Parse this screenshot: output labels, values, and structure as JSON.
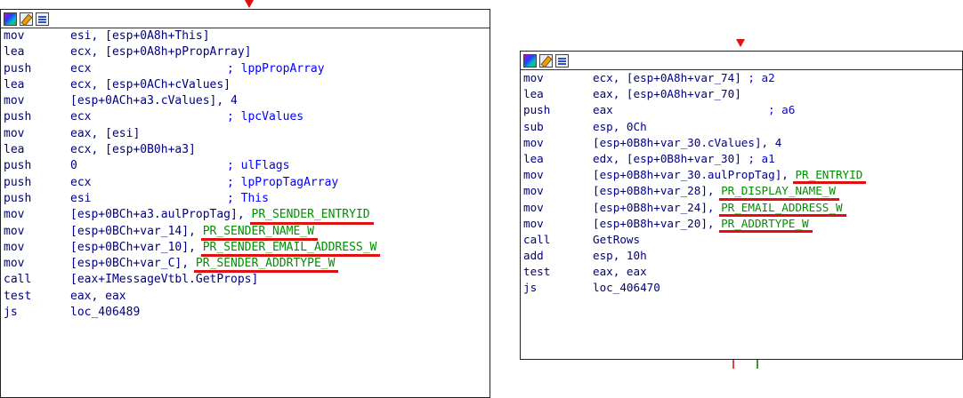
{
  "colors": {
    "mnemonic": "#000080",
    "comment": "#0000ff",
    "constant": "#008000",
    "underline": "#e01010",
    "arrow": "#e01010"
  },
  "panel_left": {
    "icons": [
      "graph-view-icon",
      "edit-icon",
      "list-view-icon"
    ],
    "lines": [
      {
        "m": "mov",
        "o": "esi, [esp+0A8h+This]"
      },
      {
        "m": "lea",
        "o": "ecx, [esp+0A8h+pPropArray]"
      },
      {
        "m": "push",
        "o": "ecx",
        "c": "; lppPropArray"
      },
      {
        "m": "lea",
        "o": "ecx, [esp+0ACh+cValues]"
      },
      {
        "m": "mov",
        "o": "[esp+0ACh+a3.cValues], 4"
      },
      {
        "m": "push",
        "o": "ecx",
        "c": "; lpcValues"
      },
      {
        "m": "mov",
        "o": "eax, [esi]"
      },
      {
        "m": "lea",
        "o": "ecx, [esp+0B0h+a3]"
      },
      {
        "m": "push",
        "o": "0",
        "c": "; ulFlags"
      },
      {
        "m": "push",
        "o": "ecx",
        "c": "; lpPropTagArray"
      },
      {
        "m": "push",
        "o": "esi",
        "c": "; This"
      },
      {
        "m": "mov",
        "o": "[esp+0BCh+a3.aulPropTag], ",
        "h": "PR_SENDER_ENTRYID"
      },
      {
        "m": "mov",
        "o": "[esp+0BCh+var_14], ",
        "h": "PR_SENDER_NAME_W"
      },
      {
        "m": "mov",
        "o": "[esp+0BCh+var_10], ",
        "h": "PR_SENDER_EMAIL_ADDRESS_W"
      },
      {
        "m": "mov",
        "o": "[esp+0BCh+var_C], ",
        "h": "PR_SENDER_ADDRTYPE_W"
      },
      {
        "m": "call",
        "o": "[eax+IMessageVtbl.GetProps]"
      },
      {
        "m": "test",
        "o": "eax, eax"
      },
      {
        "m": "js",
        "o": "loc_406489"
      }
    ]
  },
  "panel_right": {
    "icons": [
      "graph-view-icon",
      "edit-icon",
      "list-view-icon"
    ],
    "lines": [
      {
        "m": "mov",
        "o": "ecx, [esp+0A8h+var_74] ",
        "c": "; a2"
      },
      {
        "m": "lea",
        "o": "eax, [esp+0A8h+var_70]"
      },
      {
        "m": "push",
        "o": "eax",
        "c": "; a6"
      },
      {
        "m": "sub",
        "o": "esp, 0Ch"
      },
      {
        "m": "mov",
        "o": "[esp+0B8h+var_30.cValues], 4"
      },
      {
        "m": "lea",
        "o": "edx, [esp+0B8h+var_30] ",
        "c": "; a1"
      },
      {
        "m": "mov",
        "o": "[esp+0B8h+var_30.aulPropTag], ",
        "h": "PR_ENTRYID"
      },
      {
        "m": "mov",
        "o": "[esp+0B8h+var_28], ",
        "h": "PR_DISPLAY_NAME_W"
      },
      {
        "m": "mov",
        "o": "[esp+0B8h+var_24], ",
        "h": "PR_EMAIL_ADDRESS_W"
      },
      {
        "m": "mov",
        "o": "[esp+0B8h+var_20], ",
        "h": "PR_ADDRTYPE_W"
      },
      {
        "m": "call",
        "o": "GetRows"
      },
      {
        "m": "add",
        "o": "esp, 10h"
      },
      {
        "m": "test",
        "o": "eax, eax"
      },
      {
        "m": "js",
        "o": "loc_406470"
      }
    ]
  }
}
